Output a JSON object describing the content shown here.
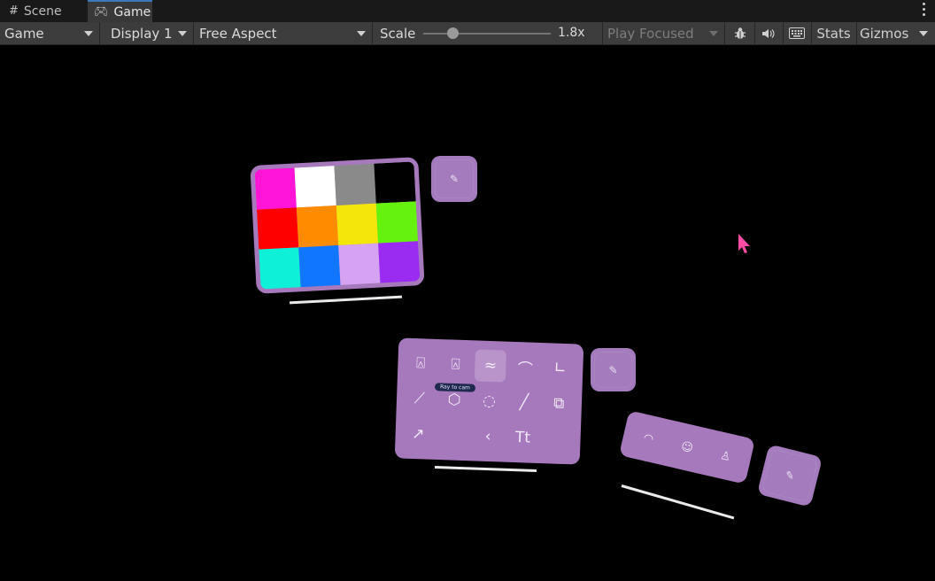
{
  "tabs": [
    {
      "label": "Scene",
      "icon": "grid-icon"
    },
    {
      "label": "Game",
      "icon": "gamepad-icon"
    }
  ],
  "toolbar": {
    "view_select": "Game",
    "display_select": "Display 1",
    "aspect_select": "Free Aspect",
    "scale_label": "Scale",
    "scale_value": "1.8x",
    "play_mode_select": "Play Focused",
    "stats_label": "Stats",
    "gizmos_label": "Gizmos"
  },
  "scale_slider_fraction": 0.2,
  "palette": {
    "colors": [
      "#ff14d8",
      "#ffffff",
      "#8a8a8a",
      "#000000",
      "#ff0000",
      "#ff8c00",
      "#f5e60a",
      "#66f20f",
      "#0ff0d8",
      "#1076ff",
      "#d6a2f2",
      "#9a2cf2"
    ]
  },
  "tool_panel": {
    "tooltip": "Ray to cam",
    "tools": [
      "⍓",
      "⍓",
      "≈",
      "⌒",
      "∟",
      "⟋",
      "⬡",
      "◌",
      "╱",
      "⧉",
      "↗",
      "",
      "‹",
      "Tt",
      ""
    ]
  },
  "accent_colors": {
    "panel": "#a679bd",
    "cursor": "#ff4da6"
  }
}
